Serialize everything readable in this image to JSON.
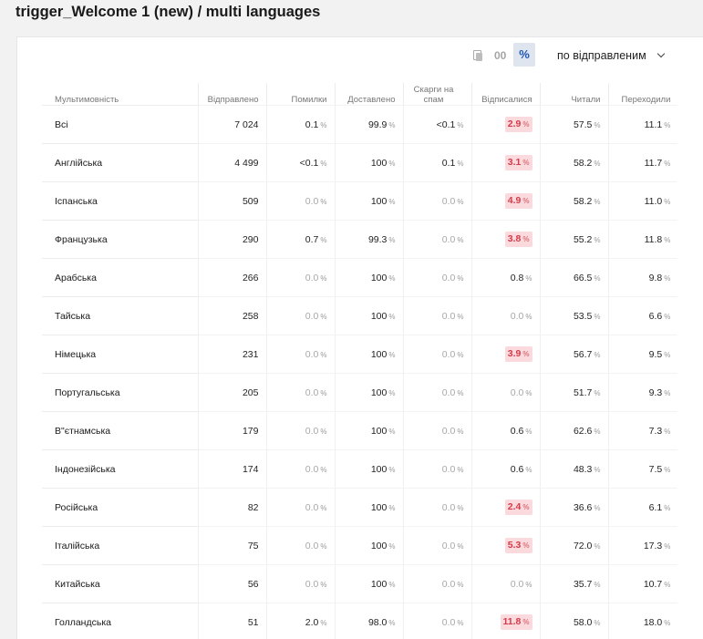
{
  "title": "trigger_Welcome 1 (new) / multi languages",
  "toolbar": {
    "abs_label": "00",
    "pct_label": "%",
    "sort_label": "по відправленим"
  },
  "colors": {
    "highlight_bg": "#fbdadd",
    "highlight_text": "#d43a4a",
    "accent": "#1e55b4"
  },
  "table": {
    "headers": [
      "Мультимовність",
      "Відправлено",
      "Помилки",
      "Доставлено",
      "Скарги на спам",
      "Відписалися",
      "Читали",
      "Переходили"
    ],
    "rows": [
      {
        "lang": "Всі",
        "sent": "7 024",
        "errors": "0.1",
        "errors_zero": false,
        "delivered": "99.9",
        "spam": "<0.1",
        "spam_zero": false,
        "unsub": "2.9",
        "unsub_hi": true,
        "unsub_zero": false,
        "read": "57.5",
        "clicks": "11.1"
      },
      {
        "lang": "Англійська",
        "sent": "4 499",
        "errors": "<0.1",
        "errors_zero": false,
        "delivered": "100",
        "spam": "0.1",
        "spam_zero": false,
        "unsub": "3.1",
        "unsub_hi": true,
        "unsub_zero": false,
        "read": "58.2",
        "clicks": "11.7"
      },
      {
        "lang": "Іспанська",
        "sent": "509",
        "errors": "0.0",
        "errors_zero": true,
        "delivered": "100",
        "spam": "0.0",
        "spam_zero": true,
        "unsub": "4.9",
        "unsub_hi": true,
        "unsub_zero": false,
        "read": "58.2",
        "clicks": "11.0"
      },
      {
        "lang": "Французька",
        "sent": "290",
        "errors": "0.7",
        "errors_zero": false,
        "delivered": "99.3",
        "spam": "0.0",
        "spam_zero": true,
        "unsub": "3.8",
        "unsub_hi": true,
        "unsub_zero": false,
        "read": "55.2",
        "clicks": "11.8"
      },
      {
        "lang": "Арабська",
        "sent": "266",
        "errors": "0.0",
        "errors_zero": true,
        "delivered": "100",
        "spam": "0.0",
        "spam_zero": true,
        "unsub": "0.8",
        "unsub_hi": false,
        "unsub_zero": false,
        "read": "66.5",
        "clicks": "9.8"
      },
      {
        "lang": "Тайська",
        "sent": "258",
        "errors": "0.0",
        "errors_zero": true,
        "delivered": "100",
        "spam": "0.0",
        "spam_zero": true,
        "unsub": "0.0",
        "unsub_hi": false,
        "unsub_zero": true,
        "read": "53.5",
        "clicks": "6.6"
      },
      {
        "lang": "Німецька",
        "sent": "231",
        "errors": "0.0",
        "errors_zero": true,
        "delivered": "100",
        "spam": "0.0",
        "spam_zero": true,
        "unsub": "3.9",
        "unsub_hi": true,
        "unsub_zero": false,
        "read": "56.7",
        "clicks": "9.5"
      },
      {
        "lang": "Португальська",
        "sent": "205",
        "errors": "0.0",
        "errors_zero": true,
        "delivered": "100",
        "spam": "0.0",
        "spam_zero": true,
        "unsub": "0.0",
        "unsub_hi": false,
        "unsub_zero": true,
        "read": "51.7",
        "clicks": "9.3"
      },
      {
        "lang": "В\"єтнамська",
        "sent": "179",
        "errors": "0.0",
        "errors_zero": true,
        "delivered": "100",
        "spam": "0.0",
        "spam_zero": true,
        "unsub": "0.6",
        "unsub_hi": false,
        "unsub_zero": false,
        "read": "62.6",
        "clicks": "7.3"
      },
      {
        "lang": "Індонезійська",
        "sent": "174",
        "errors": "0.0",
        "errors_zero": true,
        "delivered": "100",
        "spam": "0.0",
        "spam_zero": true,
        "unsub": "0.6",
        "unsub_hi": false,
        "unsub_zero": false,
        "read": "48.3",
        "clicks": "7.5"
      },
      {
        "lang": "Російська",
        "sent": "82",
        "errors": "0.0",
        "errors_zero": true,
        "delivered": "100",
        "spam": "0.0",
        "spam_zero": true,
        "unsub": "2.4",
        "unsub_hi": true,
        "unsub_zero": false,
        "read": "36.6",
        "clicks": "6.1"
      },
      {
        "lang": "Італійська",
        "sent": "75",
        "errors": "0.0",
        "errors_zero": true,
        "delivered": "100",
        "spam": "0.0",
        "spam_zero": true,
        "unsub": "5.3",
        "unsub_hi": true,
        "unsub_zero": false,
        "read": "72.0",
        "clicks": "17.3"
      },
      {
        "lang": "Китайська",
        "sent": "56",
        "errors": "0.0",
        "errors_zero": true,
        "delivered": "100",
        "spam": "0.0",
        "spam_zero": true,
        "unsub": "0.0",
        "unsub_hi": false,
        "unsub_zero": true,
        "read": "35.7",
        "clicks": "10.7"
      },
      {
        "lang": "Голландська",
        "sent": "51",
        "errors": "2.0",
        "errors_zero": false,
        "delivered": "98.0",
        "spam": "0.0",
        "spam_zero": true,
        "unsub": "11.8",
        "unsub_hi": true,
        "unsub_zero": false,
        "read": "58.0",
        "clicks": "18.0"
      }
    ],
    "unit": "%"
  }
}
